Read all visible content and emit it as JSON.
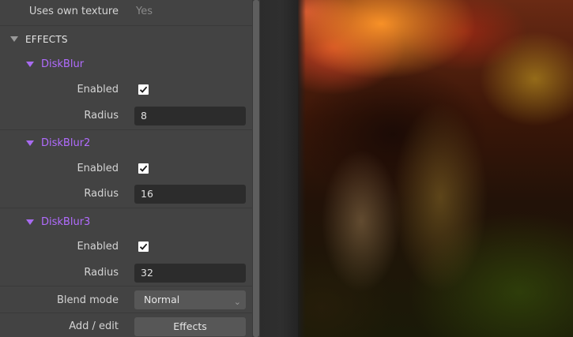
{
  "properties": {
    "uses_own_texture": {
      "label": "Uses own texture",
      "value": "Yes"
    }
  },
  "effects_section": {
    "title": "EFFECTS",
    "effects": [
      {
        "name": "DiskBlur",
        "enabled_label": "Enabled",
        "enabled": true,
        "radius_label": "Radius",
        "radius": "8"
      },
      {
        "name": "DiskBlur2",
        "enabled_label": "Enabled",
        "enabled": true,
        "radius_label": "Radius",
        "radius": "16"
      },
      {
        "name": "DiskBlur3",
        "enabled_label": "Enabled",
        "enabled": true,
        "radius_label": "Radius",
        "radius": "32"
      }
    ],
    "blend_mode": {
      "label": "Blend mode",
      "value": "Normal"
    },
    "add_edit": {
      "label": "Add / edit",
      "button_label": "Effects"
    }
  },
  "colors": {
    "panel_bg": "#434343",
    "effect_title": "#b26cff",
    "input_bg": "#2c2c2c",
    "button_bg": "#575757"
  },
  "icons": {
    "section_toggle": "triangle-down-icon",
    "effect_toggle": "triangle-down-icon",
    "checkbox": "checkmark-icon",
    "dropdown": "chevron-down-icon"
  }
}
